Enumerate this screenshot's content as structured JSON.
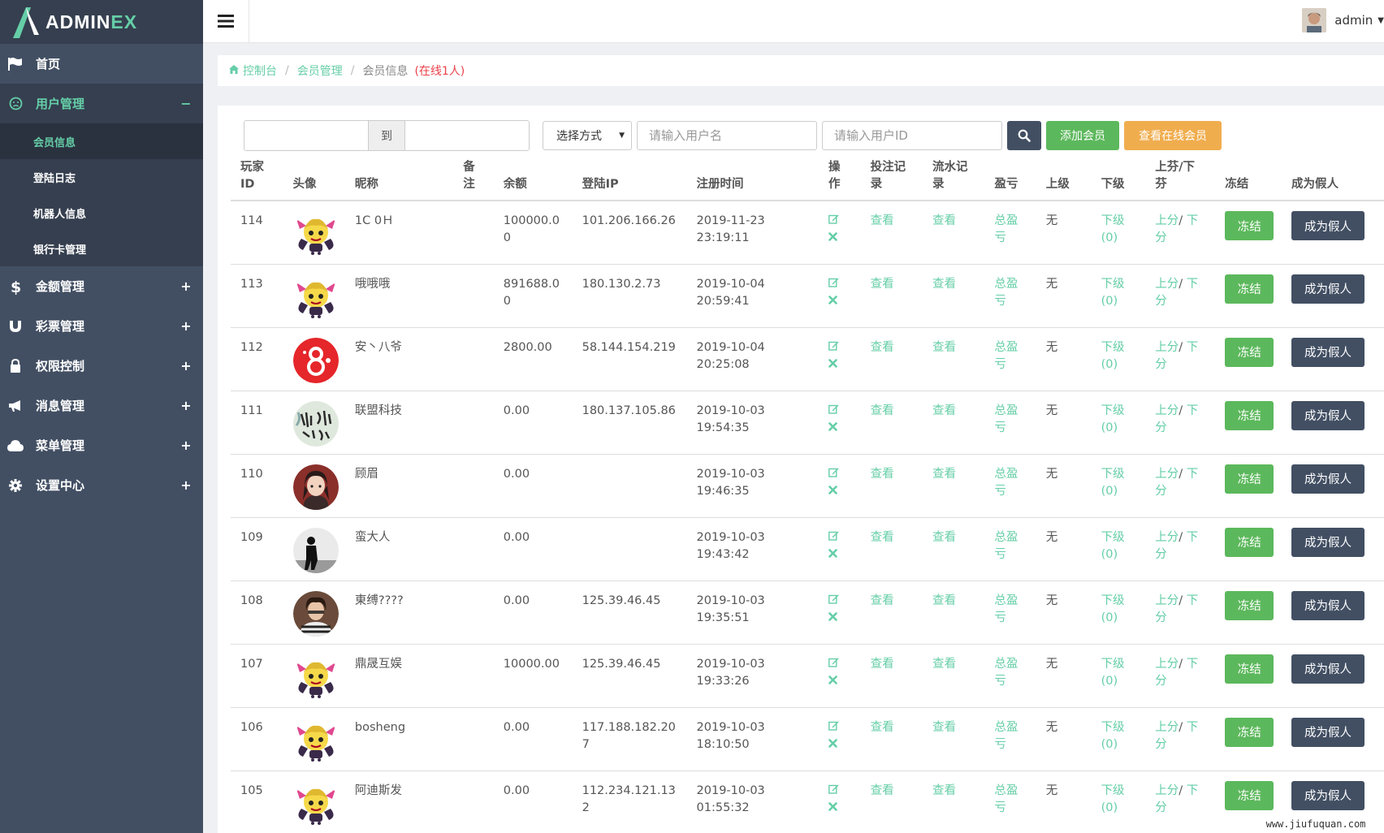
{
  "logo": {
    "text_main": "ADMIN",
    "text_accent": "EX"
  },
  "sidebar": {
    "items": [
      {
        "label": "首页",
        "icon": "flag-icon",
        "toggle": ""
      },
      {
        "label": "用户管理",
        "icon": "smile-icon",
        "toggle": "−",
        "active": true,
        "subitems": [
          {
            "label": "会员信息",
            "current": true
          },
          {
            "label": "登陆日志"
          },
          {
            "label": "机器人信息"
          },
          {
            "label": "银行卡管理"
          }
        ]
      },
      {
        "label": "金额管理",
        "icon": "dollar-icon",
        "toggle": "+"
      },
      {
        "label": "彩票管理",
        "icon": "magnet-icon",
        "toggle": "+"
      },
      {
        "label": "权限控制",
        "icon": "lock-icon",
        "toggle": "+"
      },
      {
        "label": "消息管理",
        "icon": "bullhorn-icon",
        "toggle": "+"
      },
      {
        "label": "菜单管理",
        "icon": "cloud-icon",
        "toggle": "+"
      },
      {
        "label": "设置中心",
        "icon": "gear-icon",
        "toggle": "+"
      }
    ]
  },
  "header": {
    "username": "admin"
  },
  "breadcrumb": {
    "home": "控制台",
    "section": "会员管理",
    "current": "会员信息",
    "online": "(在线1人)"
  },
  "filters": {
    "date_to": "到",
    "select_value": "选择方式",
    "username_placeholder": "请输入用户名",
    "userid_placeholder": "请输入用户ID",
    "add_label": "添加会员",
    "online_label": "查看在线会员"
  },
  "table": {
    "headers": [
      "玩家ID",
      "头像",
      "昵称",
      "备注",
      "余额",
      "登陆IP",
      "注册时间",
      "操作",
      "投注记录",
      "流水记录",
      "盈亏",
      "上级",
      "下级",
      "上芬/下芬",
      "冻结",
      "成为假人"
    ],
    "view_label": "查看",
    "profit_label": "总盈亏",
    "parent_value": "无",
    "child_label": "下级",
    "child_count": "(0)",
    "up_label": "上分",
    "down_label": "下分",
    "freeze_label": "冻结",
    "fake_label": "成为假人",
    "rows": [
      {
        "id": "114",
        "avatar": "devil",
        "nickname": "1C 0Ｈ",
        "balance": "100000.00",
        "ip": "101.206.166.26",
        "date": "2019-11-23",
        "time": "23:19:11"
      },
      {
        "id": "113",
        "avatar": "devil",
        "nickname": "哦哦哦",
        "balance": "891688.00",
        "ip": "180.130.2.73",
        "date": "2019-10-04",
        "time": "20:59:41"
      },
      {
        "id": "112",
        "avatar": "red8",
        "nickname": "安丶八爷",
        "balance": "2800.00",
        "ip": "58.144.154.219",
        "date": "2019-10-04",
        "time": "20:25:08"
      },
      {
        "id": "111",
        "avatar": "ink",
        "nickname": "联盟科技",
        "balance": "0.00",
        "ip": "180.137.105.86",
        "date": "2019-10-03",
        "time": "19:54:35"
      },
      {
        "id": "110",
        "avatar": "anime",
        "nickname": "顾眉",
        "balance": "0.00",
        "ip": "",
        "date": "2019-10-03",
        "time": "19:46:35"
      },
      {
        "id": "109",
        "avatar": "silhouette",
        "nickname": "蛮大人",
        "balance": "0.00",
        "ip": "",
        "date": "2019-10-03",
        "time": "19:43:42"
      },
      {
        "id": "108",
        "avatar": "girl",
        "nickname": "東缚????",
        "balance": "0.00",
        "ip": "125.39.46.45",
        "date": "2019-10-03",
        "time": "19:35:51"
      },
      {
        "id": "107",
        "avatar": "devil",
        "nickname": "鼎晟互娱",
        "balance": "10000.00",
        "ip": "125.39.46.45",
        "date": "2019-10-03",
        "time": "19:33:26"
      },
      {
        "id": "106",
        "avatar": "devil",
        "nickname": "bosheng",
        "balance": "0.00",
        "ip": "117.188.182.207",
        "date": "2019-10-03",
        "time": "18:10:50"
      },
      {
        "id": "105",
        "avatar": "devil",
        "nickname": "阿迪斯发",
        "balance": "0.00",
        "ip": "112.234.121.132",
        "date": "2019-10-03",
        "time": "01:55:32"
      }
    ]
  },
  "watermark": "www.jiufuquan.com",
  "colors": {
    "sidebar": "#424f63",
    "accent": "#65cea7",
    "green": "#5cb85c",
    "orange": "#f0ad4e",
    "red": "#e9424a"
  }
}
